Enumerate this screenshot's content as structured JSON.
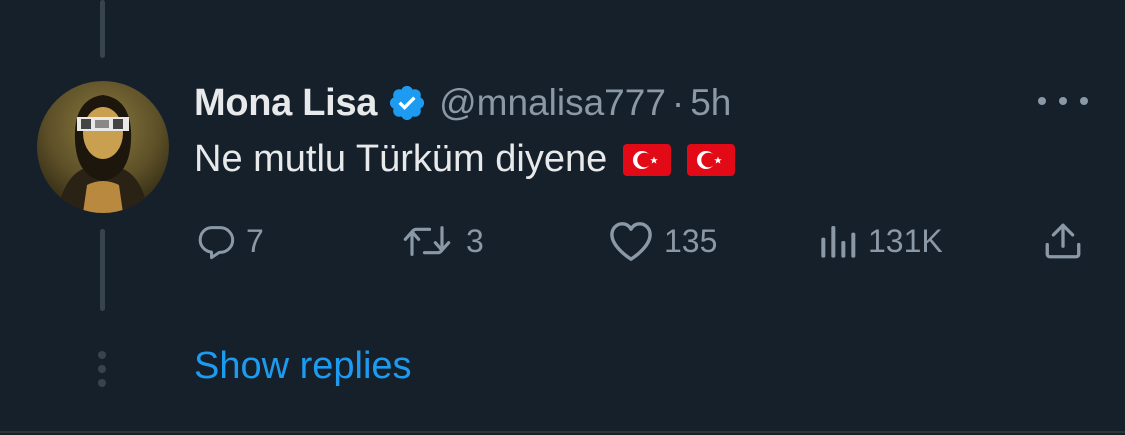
{
  "tweet": {
    "display_name": "Mona Lisa",
    "verified": true,
    "handle": "@mnalisa777",
    "separator": "·",
    "time": "5h",
    "text": "Ne mutlu Türküm diyene",
    "emojis": [
      "turkey-flag",
      "turkey-flag"
    ],
    "avatar": "mona-lisa-portrait"
  },
  "actions": {
    "replies": "7",
    "retweets": "3",
    "likes": "135",
    "views": "131K"
  },
  "icons": {
    "reply": "reply-icon",
    "retweet": "retweet-icon",
    "like": "heart-icon",
    "views": "views-icon",
    "share": "share-icon",
    "more": "more-icon",
    "verified": "verified-badge-icon"
  },
  "show_replies_label": "Show replies",
  "colors": {
    "background": "#15202b",
    "text": "#e7e9ea",
    "muted": "#8b98a5",
    "accent": "#1d9bf0",
    "thread_line": "#38444d",
    "flag_red": "#e30a17"
  }
}
